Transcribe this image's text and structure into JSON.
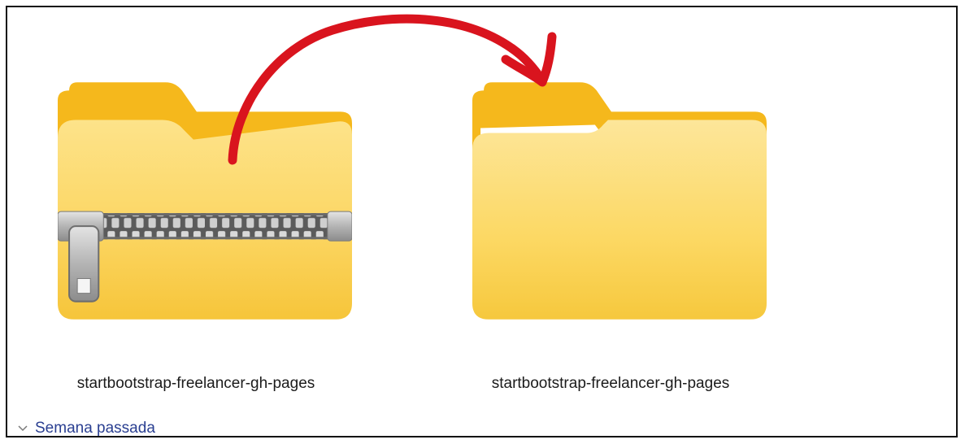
{
  "items": [
    {
      "name": "startbootstrap-freelancer-gh-pages",
      "type": "compressed-folder",
      "icon": "zip-folder-icon"
    },
    {
      "name": "startbootstrap-freelancer-gh-pages",
      "type": "folder",
      "icon": "folder-icon"
    }
  ],
  "group": {
    "label": "Semana passada",
    "icon": "chevron-down-icon"
  },
  "annotation": {
    "type": "hand-drawn-arrow",
    "from": "compressed-folder",
    "to": "folder",
    "color": "#d9141e"
  },
  "colors": {
    "folder_back": "#f5b81c",
    "folder_front": "#fcd968",
    "folder_front_bottom": "#f6c93d",
    "zipper_metal": "#b9b9b9",
    "group_label": "#2a3f91",
    "arrow": "#d9141e"
  }
}
